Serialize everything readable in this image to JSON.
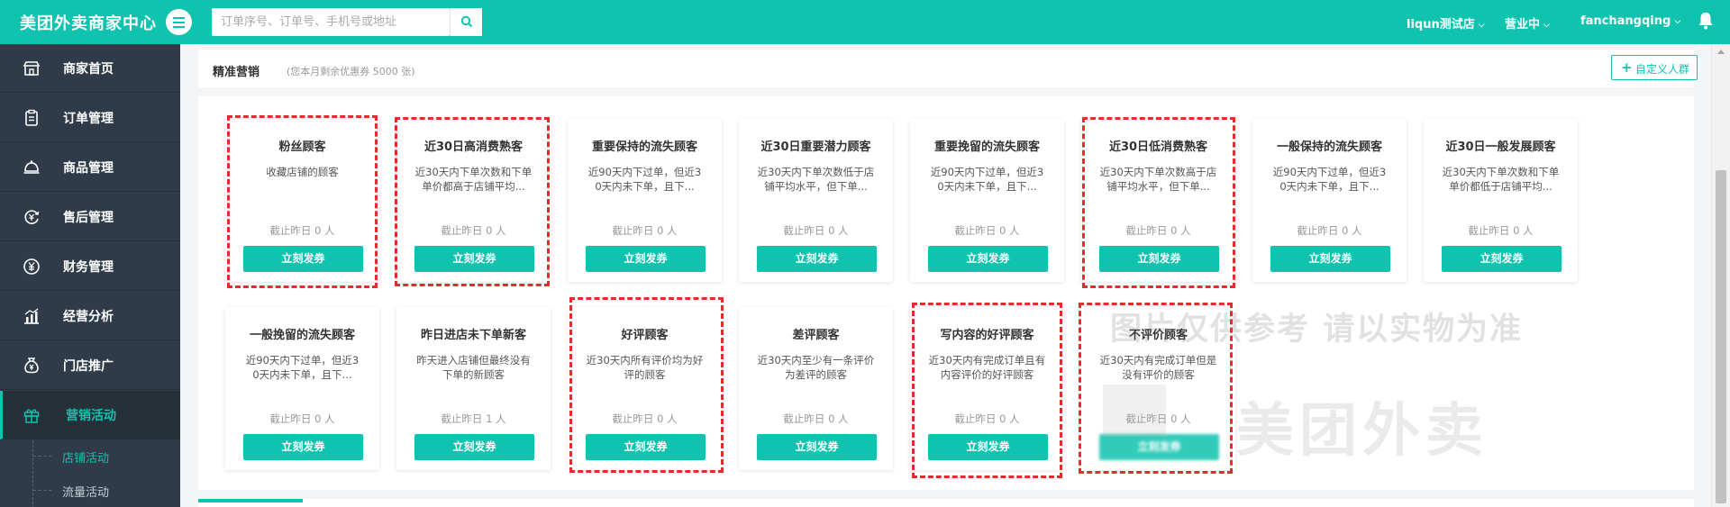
{
  "app": {
    "brand": "美团外卖商家中心",
    "search_placeholder": "订单序号、订单号、手机号或地址",
    "store_name": "liqun测试店",
    "status": "营业中",
    "username": "fanchangqing"
  },
  "sidebar": {
    "items": [
      {
        "label": "商家首页",
        "icon": "shop-icon"
      },
      {
        "label": "订单管理",
        "icon": "order-list-icon"
      },
      {
        "label": "商品管理",
        "icon": "dish-cover-icon"
      },
      {
        "label": "售后管理",
        "icon": "after-sales-icon"
      },
      {
        "label": "财务管理",
        "icon": "yen-icon"
      },
      {
        "label": "经营分析",
        "icon": "bar-chart-icon"
      },
      {
        "label": "门店推广",
        "icon": "money-bag-icon"
      },
      {
        "label": "营销活动",
        "icon": "gift-icon"
      }
    ],
    "subitems": [
      {
        "label": "店铺活动"
      },
      {
        "label": "流量活动"
      }
    ]
  },
  "panel": {
    "title": "精准营销",
    "subtitle": "(您本月剩余优惠券 5000 张)",
    "custom_button": "自定义人群"
  },
  "cards": [
    {
      "title": "粉丝顾客",
      "desc": "收藏店铺的顾客",
      "count": "截止昨日 0 人",
      "button": "立刻发券"
    },
    {
      "title": "近30日高消费熟客",
      "desc": "近30天内下单次数和下单单价都高于店铺平均...",
      "count": "截止昨日 0 人",
      "button": "立刻发券"
    },
    {
      "title": "重要保持的流失顾客",
      "desc": "近90天内下过单，但近30天内未下单，且下...",
      "count": "截止昨日 0 人",
      "button": "立刻发券"
    },
    {
      "title": "近30日重要潜力顾客",
      "desc": "近30天内下单次数低于店铺平均水平，但下单...",
      "count": "截止昨日 0 人",
      "button": "立刻发券"
    },
    {
      "title": "重要挽留的流失顾客",
      "desc": "近90天内下过单，但近30天内未下单，且下...",
      "count": "截止昨日 0 人",
      "button": "立刻发券"
    },
    {
      "title": "近30日低消费熟客",
      "desc": "近30天内下单次数高于店铺平均水平，但下单...",
      "count": "截止昨日 0 人",
      "button": "立刻发券"
    },
    {
      "title": "一般保持的流失顾客",
      "desc": "近90天内下过单，但近30天内未下单，且下...",
      "count": "截止昨日 0 人",
      "button": "立刻发券"
    },
    {
      "title": "近30日一般发展顾客",
      "desc": "近30天内下单次数和下单单价都低于店铺平均...",
      "count": "截止昨日 0 人",
      "button": "立刻发券"
    },
    {
      "title": "一般挽留的流失顾客",
      "desc": "近90天内下过单，但近30天内未下单，且下...",
      "count": "截止昨日 0 人",
      "button": "立刻发券"
    },
    {
      "title": "昨日进店未下单新客",
      "desc": "昨天进入店铺但最终没有下单的新顾客",
      "count": "截止昨日 1 人",
      "button": "立刻发券"
    },
    {
      "title": "好评顾客",
      "desc": "近30天内所有评价均为好评的顾客",
      "count": "截止昨日 0 人",
      "button": "立刻发券"
    },
    {
      "title": "差评顾客",
      "desc": "近30天内至少有一条评价为差评的顾客",
      "count": "截止昨日 0 人",
      "button": "立刻发券"
    },
    {
      "title": "写内容的好评顾客",
      "desc": "近30天内有完成订单且有内容评价的好评顾客",
      "count": "截止昨日 0 人",
      "button": "立刻发券"
    },
    {
      "title": "不评价顾客",
      "desc": "近30天内有完成订单但是没有评价的顾客",
      "count": "截止昨日 0 人",
      "button": "立刻发券"
    }
  ],
  "watermark": {
    "line1": "图片仅供参考 请以实物为准",
    "line2": "美团外卖"
  },
  "colors": {
    "brand": "#0fc3ae",
    "sidebar_bg": "#2f3b48",
    "highlight_dash": "#e52b2b"
  }
}
